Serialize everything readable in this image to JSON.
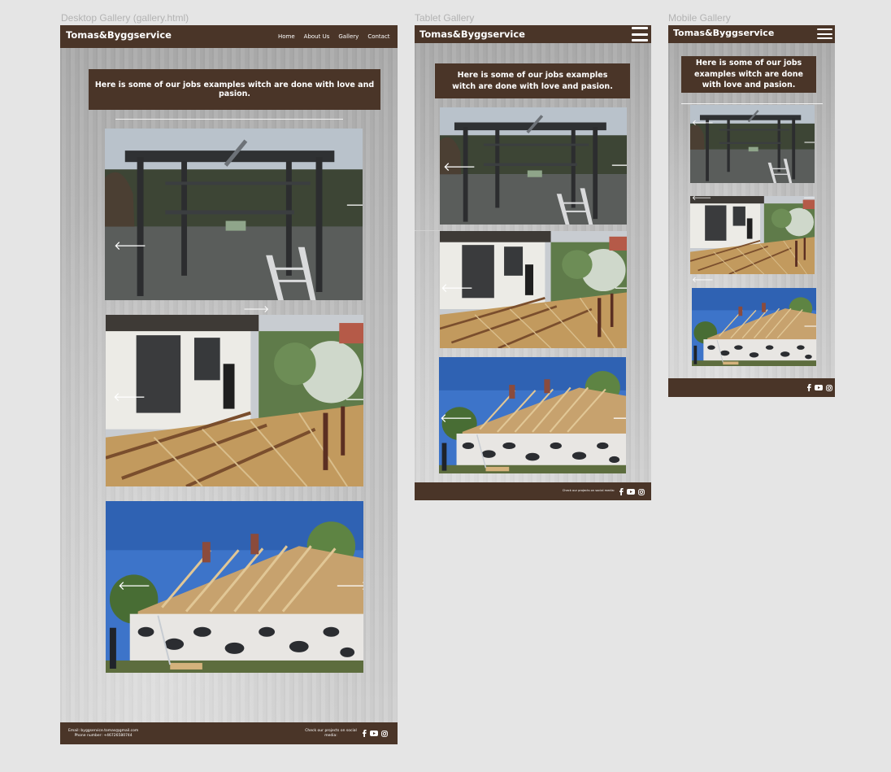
{
  "labels": {
    "desktop": "Desktop  Gallery (gallery.html)",
    "tablet": "Tablet Gallery",
    "mobile": "Mobile Gallery"
  },
  "brand": "Tomas&Byggservice",
  "nav": {
    "home": "Home",
    "about": "About Us",
    "gallery": "Gallery",
    "contact": "Contact"
  },
  "intro": "Here is some of our jobs examples witch are done with love and pasion.",
  "footer": {
    "email": "Email: byggservice.tomas@gmail.com",
    "phone": "Phone number: +46726580744",
    "social_desktop": "Check our projects on social media:",
    "social_tablet": "Check our projects on social media:"
  },
  "icons": {
    "prev": "arrow-left-icon",
    "next": "arrow-right-icon",
    "menu": "hamburger-icon",
    "facebook": "facebook-icon",
    "youtube": "youtube-icon",
    "instagram": "instagram-icon"
  },
  "colors": {
    "brand_brown": "#4a3528",
    "canvas": "#e5e5e5",
    "label": "#b3b3b3"
  },
  "arrows": {
    "prev": "🡐",
    "next": "🡒"
  }
}
